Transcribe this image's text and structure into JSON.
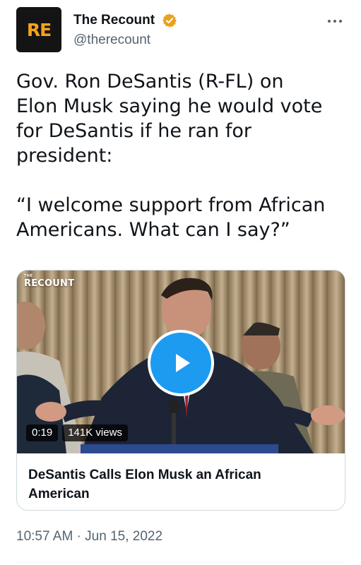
{
  "author": {
    "avatar_logo": "RE",
    "name": "The Recount",
    "handle": "@therecount",
    "verified_color": "#e8a21e"
  },
  "tweet": {
    "text": "Gov. Ron DeSantis (R-FL) on\nElon Musk saying he would vote\nfor DeSantis if he ran for\npresident:\n\n“I welcome support from African\nAmericans. What can I say?”"
  },
  "media_card": {
    "watermark_small": "THE",
    "watermark": "RECOUNT",
    "duration": "0:19",
    "views": "141K views",
    "title": "DeSantis Calls Elon Musk an African American"
  },
  "timestamp": "10:57 AM · Jun 15, 2022",
  "colors": {
    "accent": "#1d9bf0",
    "text": "#0f1419",
    "secondary": "#536471",
    "border": "#cfd9de"
  },
  "icons": {
    "verified": "verified-badge-icon",
    "more": "more-horizontal-icon",
    "play": "play-icon"
  }
}
